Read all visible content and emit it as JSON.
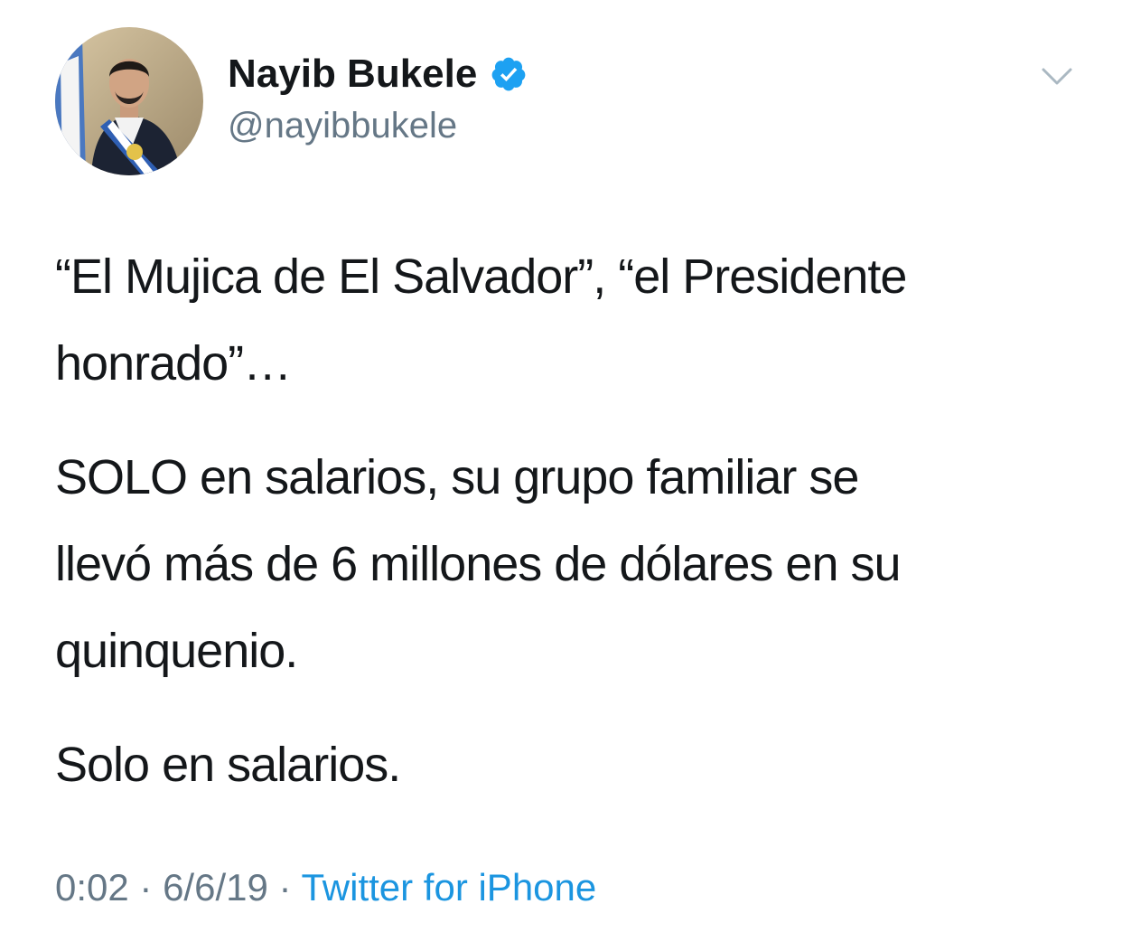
{
  "author": {
    "display_name": "Nayib Bukele",
    "handle": "@nayibbukele",
    "verified": true,
    "verified_color": "#1da1f2"
  },
  "tweet": {
    "paragraphs": [
      "“El Mujica de El Salvador”, “el Presidente\nhonrado”…",
      "SOLO en salarios, su grupo familiar se\nllevó más de 6 millones de dólares en su\nquinquenio.",
      "Solo en salarios."
    ]
  },
  "meta": {
    "time": "0:02",
    "separator": " · ",
    "date": "6/6/19",
    "source": "Twitter for iPhone"
  },
  "icons": {
    "verified": "verified-badge-icon",
    "more": "chevron-down-icon"
  },
  "colors": {
    "text": "#14171a",
    "secondary": "#657786",
    "link": "#1b95e0"
  }
}
